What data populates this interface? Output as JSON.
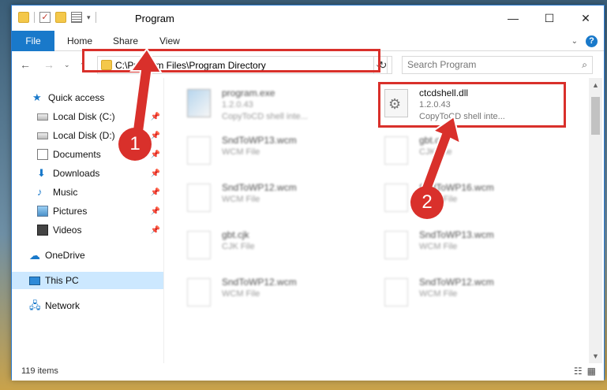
{
  "window": {
    "title": "Program"
  },
  "window_buttons": [
    "—",
    "☐",
    "✕"
  ],
  "ribbon": {
    "tabs": [
      "File",
      "Home",
      "Share",
      "View"
    ]
  },
  "address": {
    "path": "C:\\Program Files\\Program Directory"
  },
  "search": {
    "placeholder": "Search Program"
  },
  "nav": {
    "items": [
      {
        "label": "Quick access",
        "icon": "star-icon"
      },
      {
        "label": "Local Disk (C:)",
        "icon": "disk-icon"
      },
      {
        "label": "Local Disk (D:)",
        "icon": "disk-icon"
      },
      {
        "label": "Documents",
        "icon": "document-icon"
      },
      {
        "label": "Downloads",
        "icon": "download-icon"
      },
      {
        "label": "Music",
        "icon": "music-icon"
      },
      {
        "label": "Pictures",
        "icon": "pictures-icon"
      },
      {
        "label": "Videos",
        "icon": "videos-icon"
      },
      {
        "label": "OneDrive",
        "icon": "cloud-icon"
      },
      {
        "label": "This PC",
        "icon": "computer-icon"
      },
      {
        "label": "Network",
        "icon": "network-icon"
      }
    ],
    "selected": "This PC"
  },
  "files": [
    {
      "name": "program.exe",
      "version": "1.2.0.43",
      "desc": "CopyToCD shell inte..."
    },
    {
      "name": "ctcdshell.dll",
      "version": "1.2.0.43",
      "desc": "CopyToCD shell inte..."
    },
    {
      "name": "SndToWP13.wcm",
      "type": "WCM File"
    },
    {
      "name": "gbt.cjk",
      "type": "CJK File"
    },
    {
      "name": "SndToWP12.wcm",
      "type": "WCM File"
    },
    {
      "name": "SndToWP16.wcm",
      "type": "WCM File"
    },
    {
      "name": "gbt.cjk",
      "type": "CJK File"
    },
    {
      "name": "SndToWP13.wcm",
      "type": "WCM File"
    },
    {
      "name": "SndToWP12.wcm",
      "type": "WCM File"
    },
    {
      "name": "SndToWP12.wcm",
      "type": "WCM File"
    }
  ],
  "status": {
    "count": "119 items"
  },
  "steps": [
    "1",
    "2"
  ],
  "colors": {
    "accent": "#1979ca",
    "highlight": "#d9302b",
    "selected_bg": "#cce8ff"
  }
}
